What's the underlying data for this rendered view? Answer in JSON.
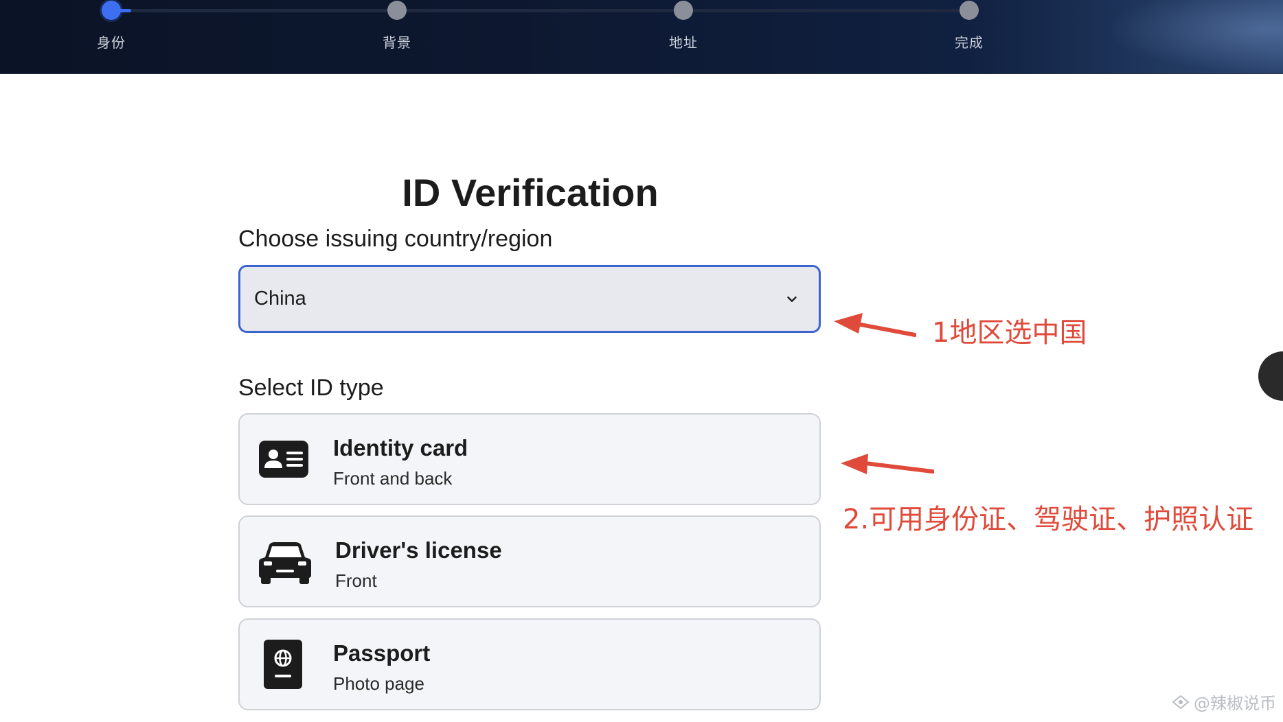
{
  "stepper": {
    "steps": [
      {
        "label": "身份",
        "active": true
      },
      {
        "label": "背景",
        "active": false
      },
      {
        "label": "地址",
        "active": false
      },
      {
        "label": "完成",
        "active": false
      }
    ]
  },
  "form": {
    "title": "ID Verification",
    "country_label": "Choose issuing country/region",
    "country_value": "China",
    "id_type_label": "Select ID type",
    "id_types": [
      {
        "title": "Identity card",
        "subtitle": "Front and back",
        "icon": "id-card-icon"
      },
      {
        "title": "Driver's license",
        "subtitle": "Front",
        "icon": "car-icon"
      },
      {
        "title": "Passport",
        "subtitle": "Photo page",
        "icon": "passport-icon"
      }
    ]
  },
  "annotations": {
    "note1": "1地区选中国",
    "note2": "2.可用身份证、驾驶证、护照认证"
  },
  "watermark": "@辣椒说币",
  "colors": {
    "accent": "#3b64d0",
    "annotation": "#e04a3a",
    "header_bg": "#0d1830"
  }
}
